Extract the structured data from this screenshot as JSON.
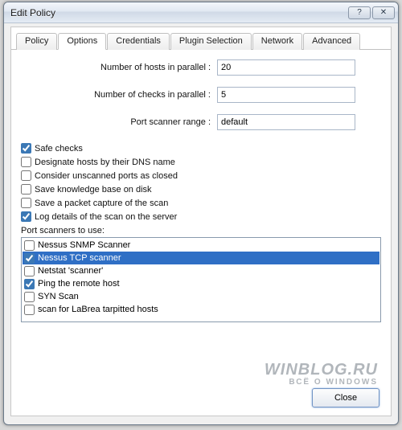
{
  "window": {
    "title": "Edit Policy",
    "help_glyph": "?",
    "close_glyph": "✕"
  },
  "tabs": {
    "items": [
      {
        "label": "Policy",
        "active": false
      },
      {
        "label": "Options",
        "active": true
      },
      {
        "label": "Credentials",
        "active": false
      },
      {
        "label": "Plugin Selection",
        "active": false
      },
      {
        "label": "Network",
        "active": false
      },
      {
        "label": "Advanced",
        "active": false
      }
    ]
  },
  "form": {
    "hosts_parallel": {
      "label": "Number of hosts in parallel :",
      "value": "20"
    },
    "checks_parallel": {
      "label": "Number of checks in parallel :",
      "value": "5"
    },
    "port_range": {
      "label": "Port scanner range :",
      "value": "default"
    }
  },
  "options": [
    {
      "label": "Safe checks",
      "checked": true
    },
    {
      "label": "Designate hosts by their DNS name",
      "checked": false
    },
    {
      "label": "Consider unscanned ports as closed",
      "checked": false
    },
    {
      "label": "Save knowledge base on disk",
      "checked": false
    },
    {
      "label": "Save a packet capture of the scan",
      "checked": false
    },
    {
      "label": "Log details of the scan on the server",
      "checked": true
    }
  ],
  "scanners": {
    "label": "Port scanners to use:",
    "items": [
      {
        "label": "Nessus SNMP Scanner",
        "checked": false,
        "selected": false
      },
      {
        "label": "Nessus TCP scanner",
        "checked": true,
        "selected": true
      },
      {
        "label": "Netstat 'scanner'",
        "checked": false,
        "selected": false
      },
      {
        "label": "Ping the remote host",
        "checked": true,
        "selected": false
      },
      {
        "label": "SYN Scan",
        "checked": false,
        "selected": false
      },
      {
        "label": "scan for LaBrea tarpitted hosts",
        "checked": false,
        "selected": false
      }
    ]
  },
  "footer": {
    "close_label": "Close"
  },
  "watermark": {
    "line1": "WINBLOG.RU",
    "line2": "ВСЁ О WINDOWS"
  }
}
